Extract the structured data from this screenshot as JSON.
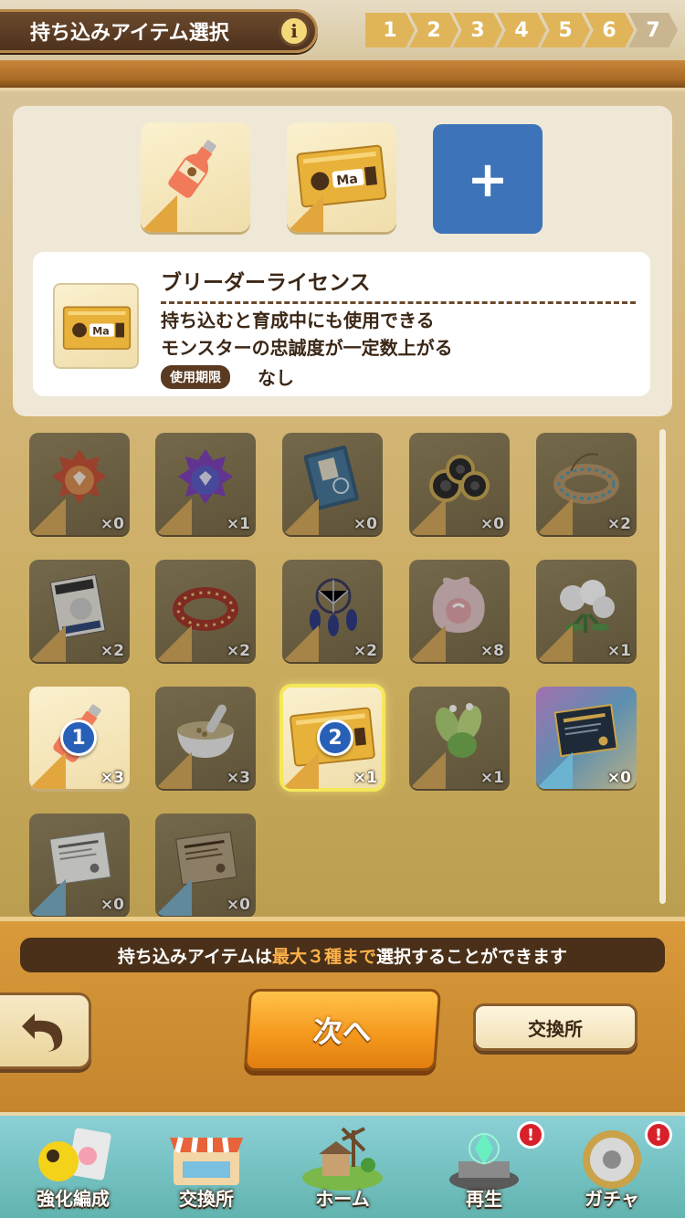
{
  "header": {
    "title": "持ち込みアイテム選択",
    "info_icon": "i",
    "steps": [
      "1",
      "2",
      "3",
      "4",
      "5",
      "6",
      "7"
    ]
  },
  "selected": {
    "slots": [
      {
        "item": "bottle"
      },
      {
        "item": "breeder-license"
      }
    ],
    "add_label": "+"
  },
  "detail": {
    "name": "ブリーダーライセンス",
    "description_line1": "持ち込むと育成中にも使用できる",
    "description_line2": "モンスターの忠誠度が一定数上がる",
    "expiry_label": "使用期限",
    "expiry_value": "なし"
  },
  "items": [
    {
      "icon": "red-fruit",
      "count": "×0"
    },
    {
      "icon": "purple-fruit",
      "count": "×1"
    },
    {
      "icon": "book",
      "count": "×0"
    },
    {
      "icon": "gears",
      "count": "×0"
    },
    {
      "icon": "bead-bracelet",
      "count": "×2"
    },
    {
      "icon": "magazine",
      "count": "×2"
    },
    {
      "icon": "red-collar",
      "count": "×2"
    },
    {
      "icon": "dreamcatcher",
      "count": "×2"
    },
    {
      "icon": "meat-bag",
      "count": "×8"
    },
    {
      "icon": "white-flowers",
      "count": "×1"
    },
    {
      "icon": "bottle",
      "count": "×3",
      "badge": "1"
    },
    {
      "icon": "grain-bowl",
      "count": "×3"
    },
    {
      "icon": "breeder-license",
      "count": "×1",
      "badge": "2"
    },
    {
      "icon": "leaves",
      "count": "×1"
    },
    {
      "icon": "certificate-dark",
      "count": "×0"
    },
    {
      "icon": "document-white",
      "count": "×0"
    },
    {
      "icon": "document-brown",
      "count": "×0"
    }
  ],
  "bottom": {
    "hint_prefix": "持ち込みアイテムは",
    "hint_highlight": "最大３種まで",
    "hint_suffix": "選択することができます",
    "next_label": "次へ",
    "exchange_label": "交換所"
  },
  "nav": [
    {
      "label": "強化編成",
      "alert": ""
    },
    {
      "label": "交換所",
      "alert": ""
    },
    {
      "label": "ホーム",
      "alert": ""
    },
    {
      "label": "再生",
      "alert": "!"
    },
    {
      "label": "ガチャ",
      "alert": "!"
    }
  ],
  "colors": {
    "accent_orange": "#f59a1e",
    "brown_dark": "#4a3018",
    "add_blue": "#3d73b9",
    "hint_highlight": "#ffb24a"
  }
}
